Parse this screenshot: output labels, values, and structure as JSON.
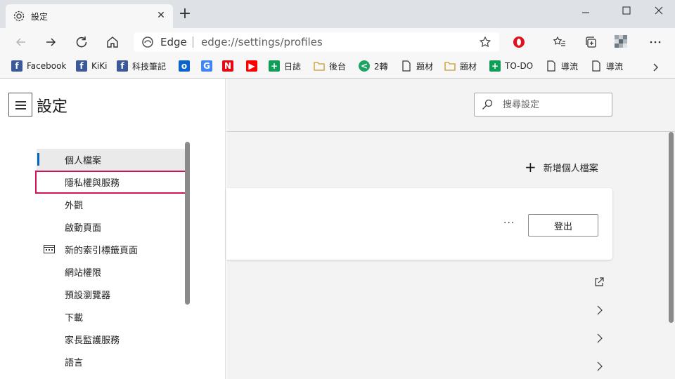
{
  "tab": {
    "title": "設定",
    "close": "✕",
    "new_tab": "+"
  },
  "window": {
    "minimize": "—",
    "maximize": "☐",
    "close": "✕"
  },
  "omnibox": {
    "site": "Edge",
    "url": "edge://settings/profiles"
  },
  "bookmarks": [
    {
      "label": "Facebook",
      "icon": "facebook-icon",
      "color": "#3b5998",
      "glyph": "f"
    },
    {
      "label": "KiKi",
      "icon": "facebook-icon",
      "color": "#3b5998",
      "glyph": "f"
    },
    {
      "label": "科技筆記",
      "icon": "facebook-icon",
      "color": "#3b5998",
      "glyph": "f"
    },
    {
      "label": "",
      "icon": "outlook-icon",
      "color": "#0a64c9",
      "glyph": "o"
    },
    {
      "label": "",
      "icon": "translate-icon",
      "color": "#4285f4",
      "glyph": "G"
    },
    {
      "label": "",
      "icon": "netflix-icon",
      "color": "#e50914",
      "glyph": "N"
    },
    {
      "label": "",
      "icon": "youtube-icon",
      "color": "#ff0000",
      "glyph": "▶"
    },
    {
      "label": "日誌",
      "icon": "sheets-icon",
      "color": "#0f9d58",
      "glyph": "+"
    },
    {
      "label": "後台",
      "icon": "folder-icon",
      "color": "#e8b63f",
      "glyph": ""
    },
    {
      "label": "2轉",
      "icon": "share-icon",
      "color": "#1da462",
      "glyph": "<"
    },
    {
      "label": "題材",
      "icon": "page-icon",
      "color": "#ffffff",
      "glyph": ""
    },
    {
      "label": "題材",
      "icon": "folder-icon",
      "color": "#e8b63f",
      "glyph": ""
    },
    {
      "label": "TO-DO",
      "icon": "sheets-icon",
      "color": "#0f9d58",
      "glyph": "+"
    },
    {
      "label": "導流",
      "icon": "page-icon",
      "color": "#ffffff",
      "glyph": ""
    },
    {
      "label": "導流",
      "icon": "page-icon",
      "color": "#ffffff",
      "glyph": ""
    }
  ],
  "settings": {
    "title": "設定",
    "search_placeholder": "搜尋設定",
    "nav": [
      {
        "label": "個人檔案",
        "active": true
      },
      {
        "label": "隱私權與服務",
        "highlighted": true
      },
      {
        "label": "外觀"
      },
      {
        "label": "啟動頁面"
      },
      {
        "label": "新的索引標籤頁面",
        "icon": "new-tab-page-icon"
      },
      {
        "label": "網站權限"
      },
      {
        "label": "預設瀏覽器"
      },
      {
        "label": "下載"
      },
      {
        "label": "家長監護服務"
      },
      {
        "label": "語言"
      }
    ],
    "add_profile": "新增個人檔案",
    "more": "···",
    "sign_out": "登出"
  },
  "colors": {
    "accent": "#0067c0",
    "highlight_border": "#d4145a"
  }
}
